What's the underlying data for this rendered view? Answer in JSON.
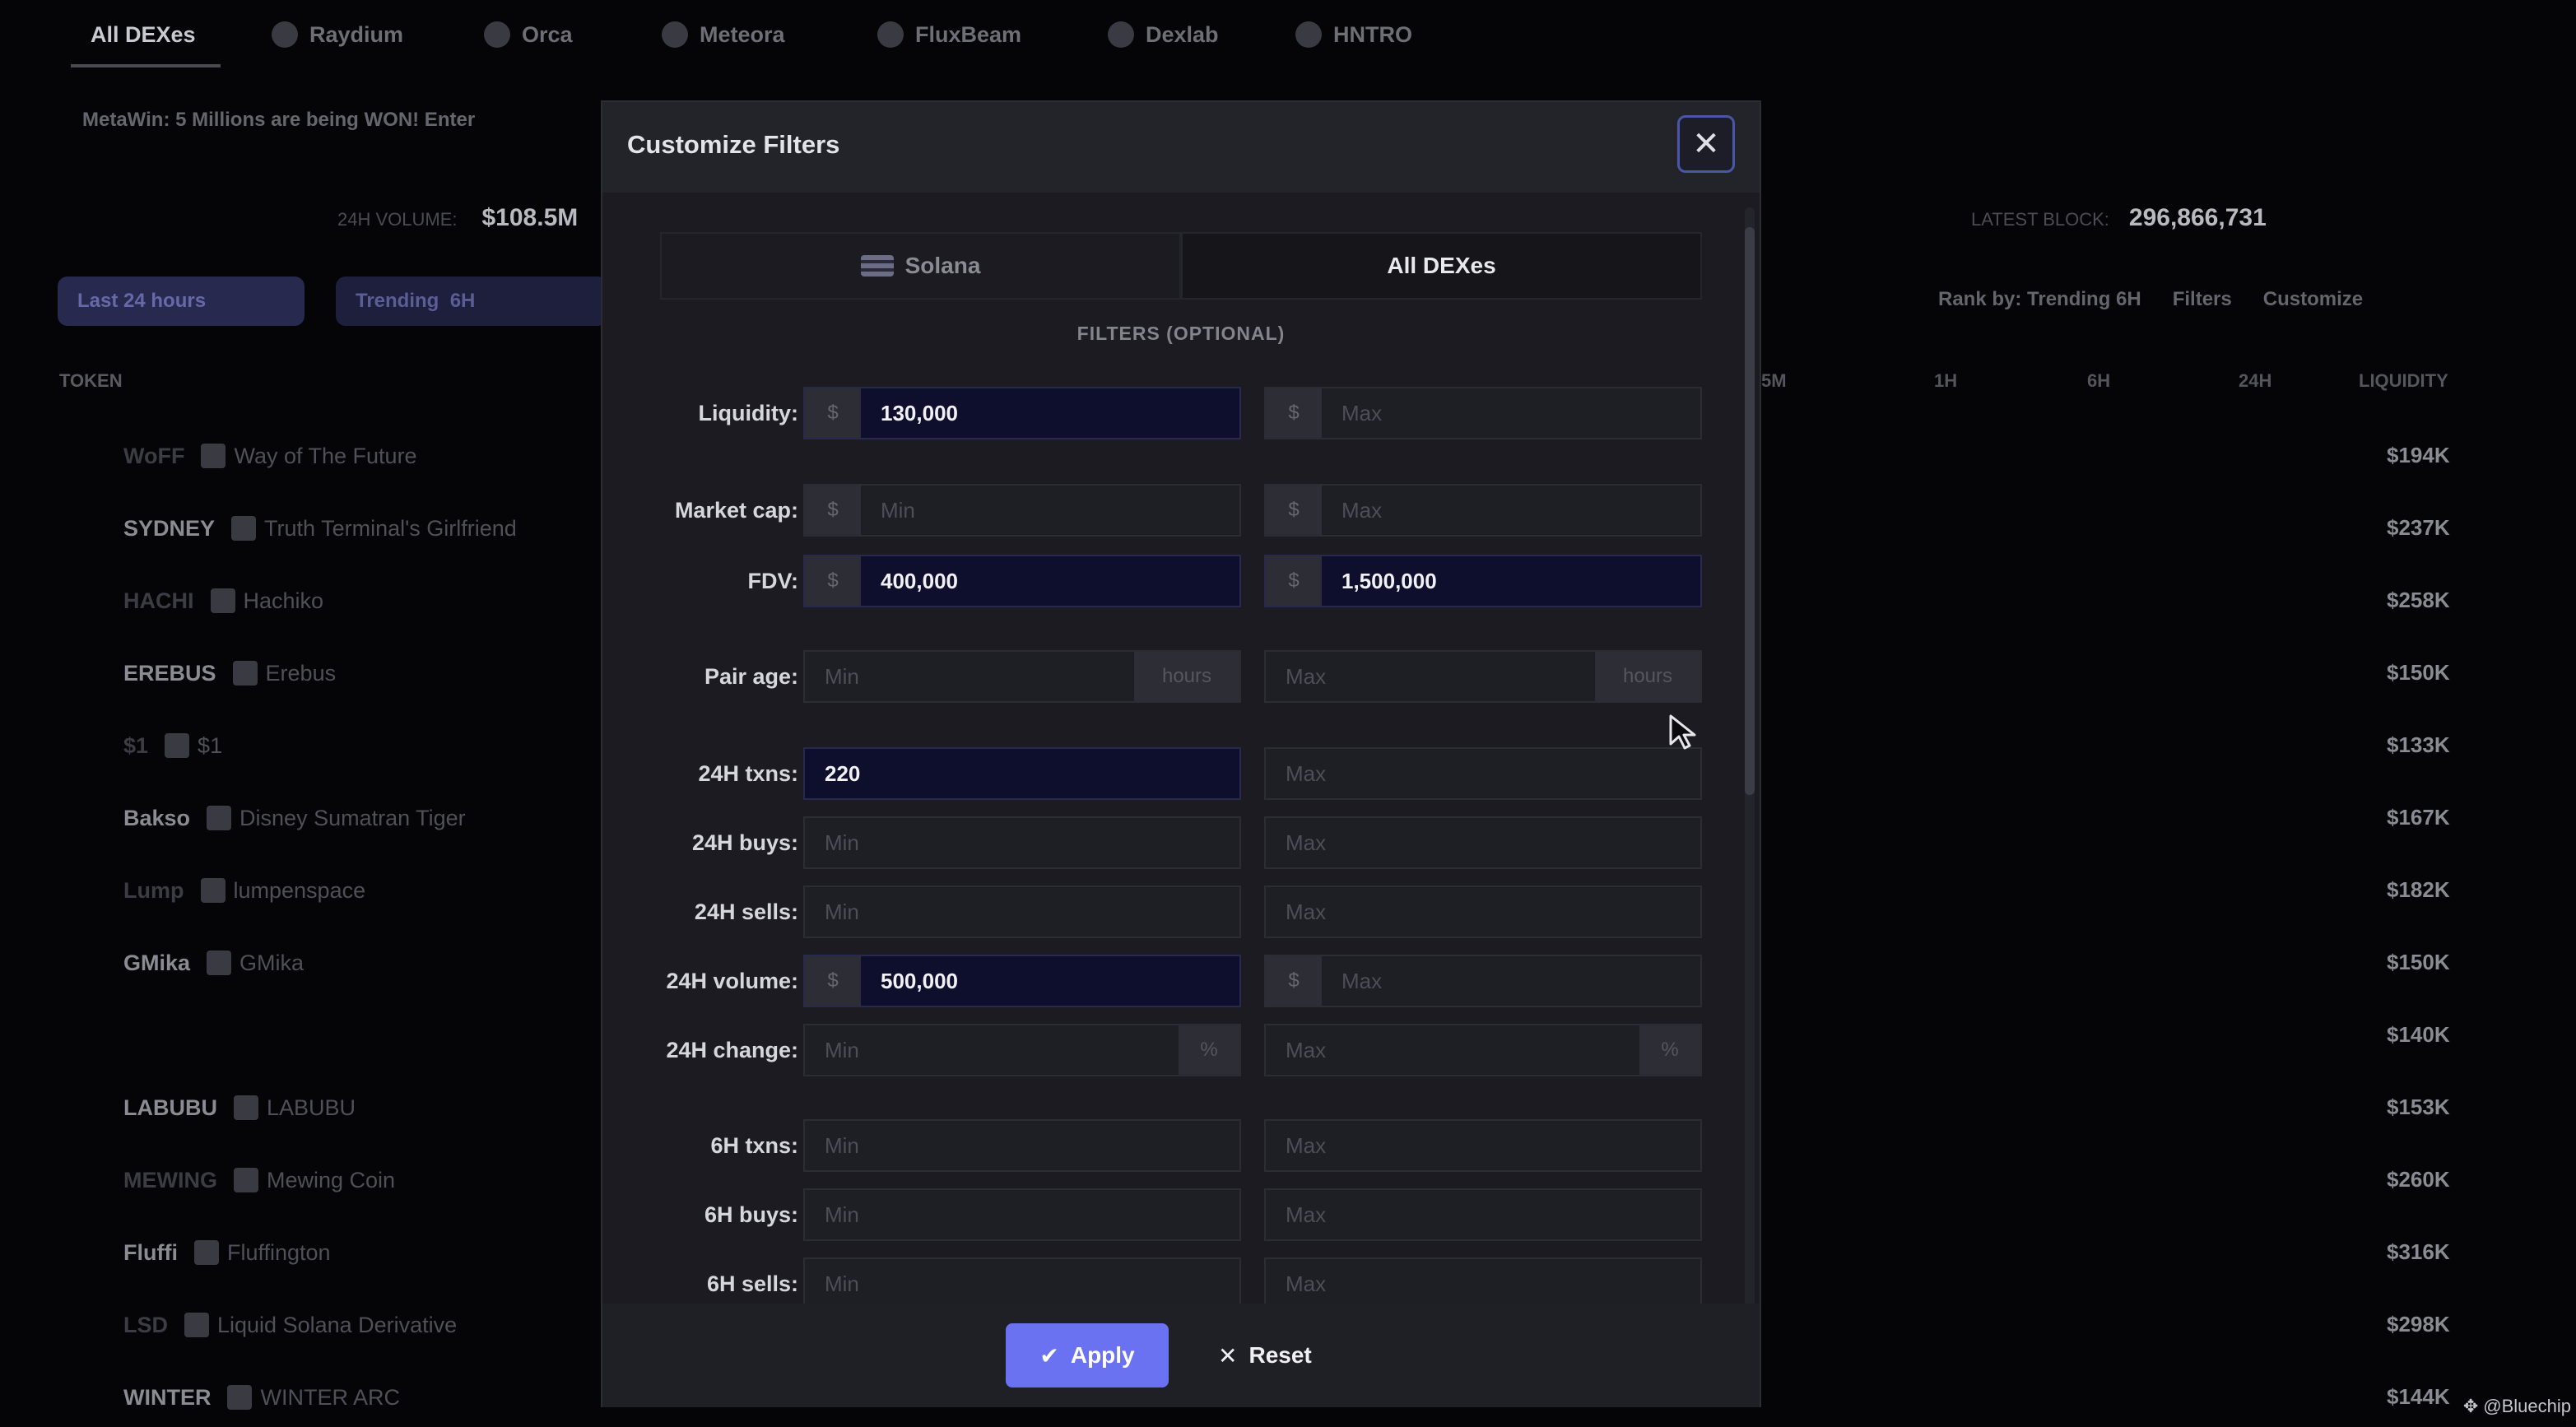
{
  "nav": {
    "tabs": [
      {
        "label": "All DEXes",
        "icon": "none"
      },
      {
        "label": "Raydium",
        "icon": "raydium-icon"
      },
      {
        "label": "Orca",
        "icon": "orca-icon"
      },
      {
        "label": "Meteora",
        "icon": "meteora-icon"
      },
      {
        "label": "FluxBeam",
        "icon": "fluxbeam-icon"
      },
      {
        "label": "Dexlab",
        "icon": "dexlab-icon"
      },
      {
        "label": "HNTRO",
        "icon": "hntro-icon"
      }
    ]
  },
  "banner": {
    "text": "MetaWin: 5 Millions are being WON! Enter"
  },
  "stats": {
    "left_label": "24H VOLUME:",
    "left_value": "$108.5M",
    "right_label": "LATEST BLOCK:",
    "right_value": "296,866,731"
  },
  "pills": {
    "last": "Last 24 hours",
    "trending": "Trending",
    "trending_sub": "6H"
  },
  "table": {
    "token_header": "TOKEN",
    "right_headers": [
      "5M",
      "1H",
      "6H",
      "24H",
      "LIQUIDITY"
    ],
    "rows": [
      {
        "symbol": "WoFF",
        "name": "Way of The Future",
        "liq": "$194K"
      },
      {
        "symbol": "SYDNEY",
        "name": "Truth Terminal's Girlfriend",
        "liq": "$237K"
      },
      {
        "symbol": "HACHI",
        "name": "Hachiko",
        "liq": "$258K"
      },
      {
        "symbol": "EREBUS",
        "name": "Erebus",
        "liq": "$150K"
      },
      {
        "symbol": "$1",
        "name": "$1",
        "liq": "$133K"
      },
      {
        "symbol": "Bakso",
        "name": "Disney Sumatran Tiger",
        "liq": "$167K"
      },
      {
        "symbol": "Lump",
        "name": "lumpenspace",
        "liq": "$182K"
      },
      {
        "symbol": "GMika",
        "name": "GMika",
        "liq": "$150K"
      },
      {
        "symbol": "",
        "name": "",
        "liq": "$140K"
      },
      {
        "symbol": "LABUBU",
        "name": "LABUBU",
        "liq": "$153K"
      },
      {
        "symbol": "MEWING",
        "name": "Mewing Coin",
        "liq": "$260K"
      },
      {
        "symbol": "Fluffi",
        "name": "Fluffington",
        "liq": "$316K"
      },
      {
        "symbol": "LSD",
        "name": "Liquid Solana Derivative",
        "liq": "$298K"
      },
      {
        "symbol": "WINTER",
        "name": "WINTER ARC",
        "liq": "$144K"
      }
    ]
  },
  "rank_bar": {
    "rank": "Rank by: Trending 6H",
    "filters": "Filters",
    "customize": "Customize"
  },
  "modal": {
    "title": "Customize Filters",
    "close_icon": "close-icon",
    "chain_label": "Solana",
    "dex_label": "All DEXes",
    "subtitle": "FILTERS (OPTIONAL)",
    "filters": [
      {
        "label": "Liquidity:",
        "min": "130,000",
        "max": "Max",
        "prefix": "$"
      },
      {
        "label": "Market cap:",
        "min": "Min",
        "max": "Max",
        "prefix": "$"
      },
      {
        "label": "FDV:",
        "min": "400,000",
        "max": "1,500,000",
        "prefix": "$"
      },
      {
        "label": "Pair age:",
        "min": "Min",
        "max": "Max",
        "suffix": "hours"
      },
      {
        "label": "24H txns:",
        "min": "220",
        "max": "Max"
      },
      {
        "label": "24H buys:",
        "min": "Min",
        "max": "Max"
      },
      {
        "label": "24H sells:",
        "min": "Min",
        "max": "Max"
      },
      {
        "label": "24H volume:",
        "min": "500,000",
        "max": "Max",
        "prefix": "$"
      },
      {
        "label": "24H change:",
        "min": "Min",
        "max": "Max",
        "suffix": "%"
      },
      {
        "label": "6H txns:",
        "min": "Min",
        "max": "Max"
      },
      {
        "label": "6H buys:",
        "min": "Min",
        "max": "Max"
      },
      {
        "label": "6H sells:",
        "min": "Min",
        "max": "Max"
      }
    ],
    "apply": "Apply",
    "reset": "Reset"
  },
  "watermark": "@Bluechip"
}
